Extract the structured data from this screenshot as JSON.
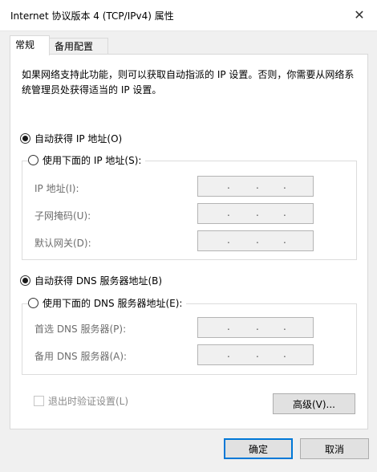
{
  "window": {
    "title": "Internet 协议版本 4 (TCP/IPv4) 属性",
    "close_glyph": "✕"
  },
  "tabs": [
    {
      "label": "常规",
      "active": true
    },
    {
      "label": "备用配置",
      "active": false
    }
  ],
  "description": "如果网络支持此功能，则可以获取自动指派的 IP 设置。否则，你需要从网络系统管理员处获得适当的 IP 设置。",
  "ip_section": {
    "auto_option": {
      "label": "自动获得 IP 地址(O)",
      "checked": true
    },
    "manual_option": {
      "label": "使用下面的 IP 地址(S):",
      "checked": false
    },
    "fields": [
      {
        "label": "IP 地址(I):",
        "value": ". . ."
      },
      {
        "label": "子网掩码(U):",
        "value": ". . ."
      },
      {
        "label": "默认网关(D):",
        "value": ". . ."
      }
    ]
  },
  "dns_section": {
    "auto_option": {
      "label": "自动获得 DNS 服务器地址(B)",
      "checked": true
    },
    "manual_option": {
      "label": "使用下面的 DNS 服务器地址(E):",
      "checked": false
    },
    "fields": [
      {
        "label": "首选 DNS 服务器(P):",
        "value": ". . ."
      },
      {
        "label": "备用 DNS 服务器(A):",
        "value": ". . ."
      }
    ]
  },
  "validate_checkbox": {
    "label": "退出时验证设置(L)",
    "checked": false,
    "enabled": false
  },
  "buttons": {
    "advanced": "高级(V)...",
    "ok": "确定",
    "cancel": "取消"
  },
  "colors": {
    "default_button_border": "#0078d7",
    "disabled_text": "#6d6d6d"
  }
}
